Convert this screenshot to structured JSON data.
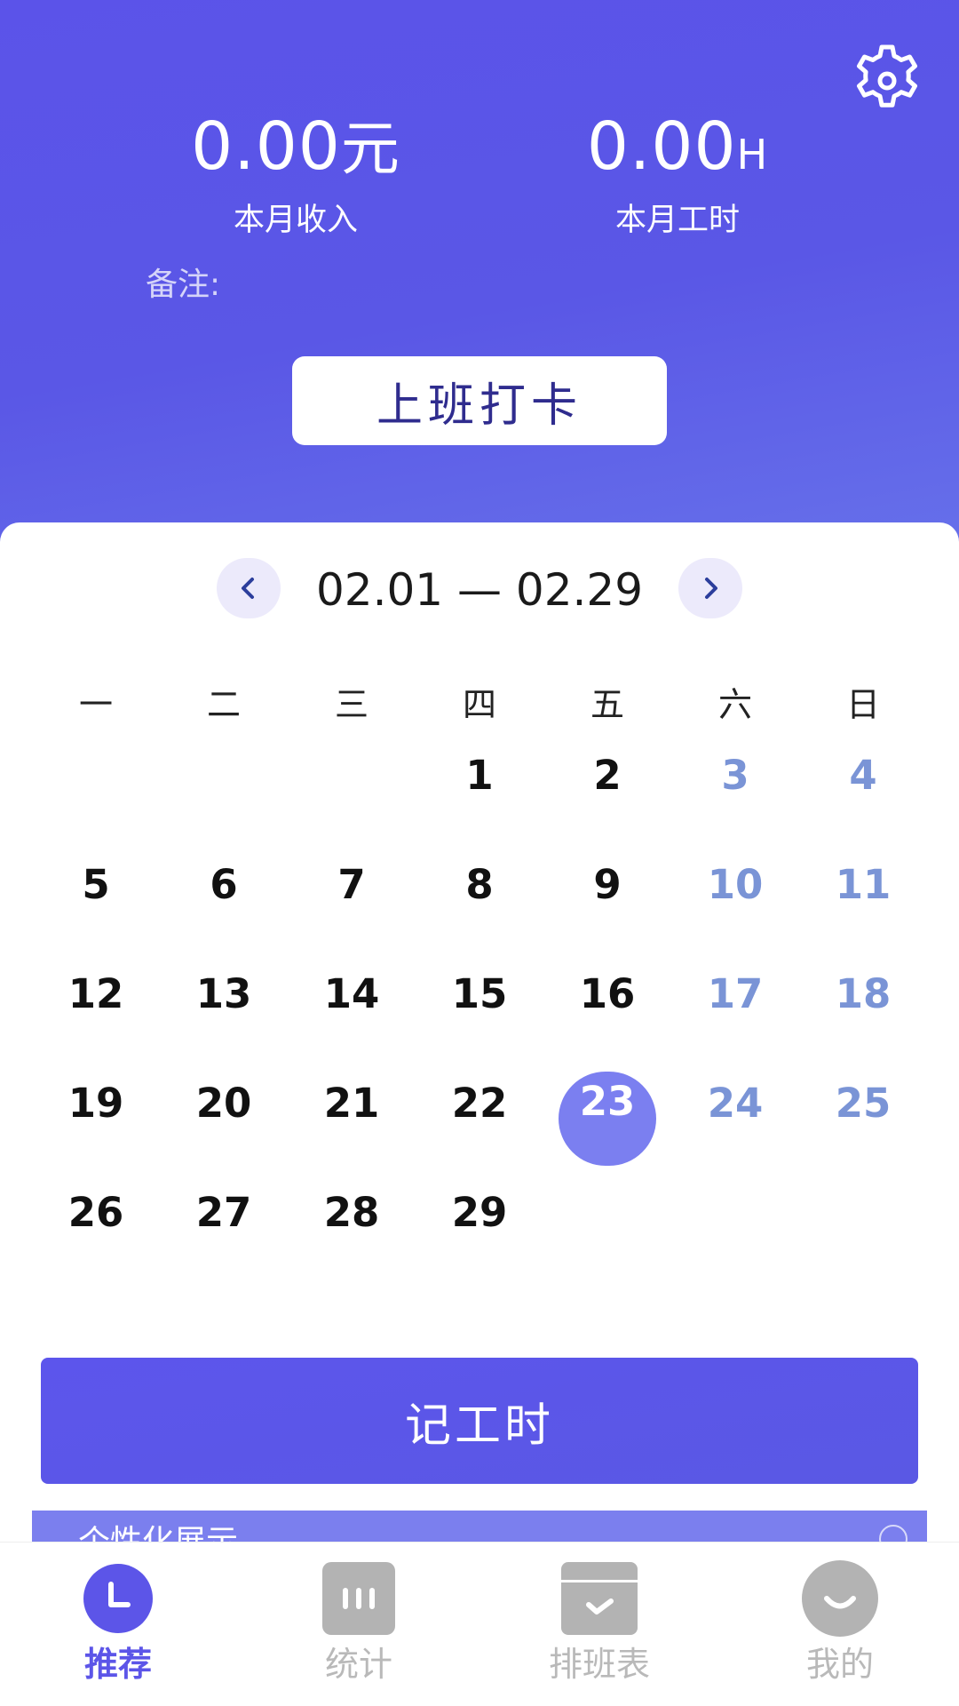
{
  "header": {
    "income": {
      "value": "0.00",
      "unit": "元",
      "label": "本月收入"
    },
    "hours": {
      "value": "0.00",
      "unit": "H",
      "label": "本月工时"
    },
    "remark_label": "备注:",
    "checkin_label": "上班打卡",
    "settings_icon": "gear-icon"
  },
  "calendar": {
    "range": "02.01 — 02.29",
    "weekdays": [
      "一",
      "二",
      "三",
      "四",
      "五",
      "六",
      "日"
    ],
    "weeks": [
      [
        "",
        "",
        "",
        "1",
        "2",
        "3",
        "4"
      ],
      [
        "5",
        "6",
        "7",
        "8",
        "9",
        "10",
        "11"
      ],
      [
        "12",
        "13",
        "14",
        "15",
        "16",
        "17",
        "18"
      ],
      [
        "19",
        "20",
        "21",
        "22",
        "23",
        "24",
        "25"
      ],
      [
        "26",
        "27",
        "28",
        "29",
        "",
        "",
        ""
      ]
    ],
    "selected_day": "23",
    "weekend_color": "#7a94d6",
    "selected_color": "#7b7ff0"
  },
  "actions": {
    "log_hours_label": "记工时",
    "banner_text": "个性化展示"
  },
  "tabbar": {
    "tabs": [
      {
        "label": "推荐",
        "icon": "clock-icon",
        "active": true
      },
      {
        "label": "统计",
        "icon": "bar-stats-icon",
        "active": false
      },
      {
        "label": "排班表",
        "icon": "schedule-check-icon",
        "active": false
      },
      {
        "label": "我的",
        "icon": "smile-profile-icon",
        "active": false
      }
    ]
  },
  "colors": {
    "primary": "#5b53e9",
    "active_tab": "#5c55e8",
    "inactive_tab": "#b9b9b9"
  }
}
